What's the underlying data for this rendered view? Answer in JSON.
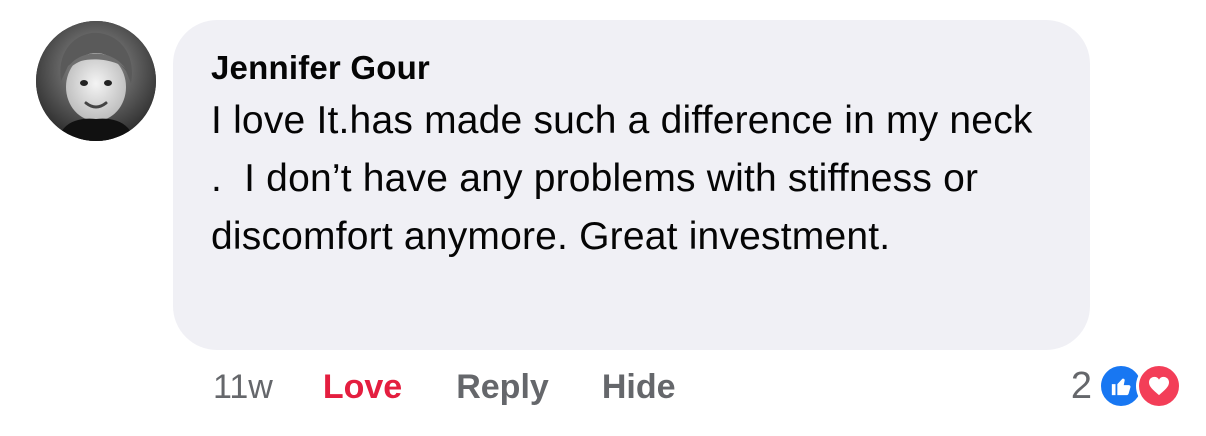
{
  "comment": {
    "author": "Jennifer Gour",
    "text": "I love It.has made such a difference in my neck .  I don’t have any problems with stiffness or discomfort anymore. Great investment.",
    "timestamp": "11w",
    "avatar_icon": "profile-photo"
  },
  "actions": {
    "love_label": "Love",
    "reply_label": "Reply",
    "hide_label": "Hide"
  },
  "reactions": {
    "count": "2",
    "types": [
      "like-icon",
      "love-icon"
    ]
  },
  "colors": {
    "bubble": "#f0f0f5",
    "love": "#e41e3f",
    "muted": "#65676b",
    "like": "#1877f2",
    "heart": "#f33e58"
  }
}
